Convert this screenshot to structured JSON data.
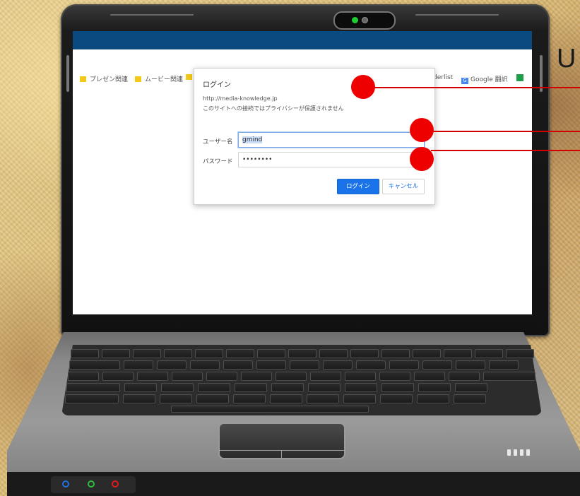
{
  "side_title": "U",
  "browser": {
    "bookmarks": [
      {
        "label": "プレゼン関連",
        "icon": "folder-icon"
      },
      {
        "label": "ムービー関連",
        "icon": "folder-icon"
      },
      {
        "label": "derlist",
        "icon": ""
      },
      {
        "label": "Google 翻訳",
        "icon": "google-translate-icon"
      }
    ]
  },
  "dialog": {
    "title": "ログイン",
    "url": "http://media-knowledge.jp",
    "warning": "このサイトへの接続ではプライバシーが保護されません",
    "username_label": "ユーザー名",
    "username_value": "gmind",
    "password_label": "パスワード",
    "password_value": "••••••••",
    "login_button": "ログイン",
    "cancel_button": "キャンセル"
  },
  "colors": {
    "titlebar": "#0b4a80",
    "login_button": "#1a73e8",
    "marker": "#ee0000"
  }
}
